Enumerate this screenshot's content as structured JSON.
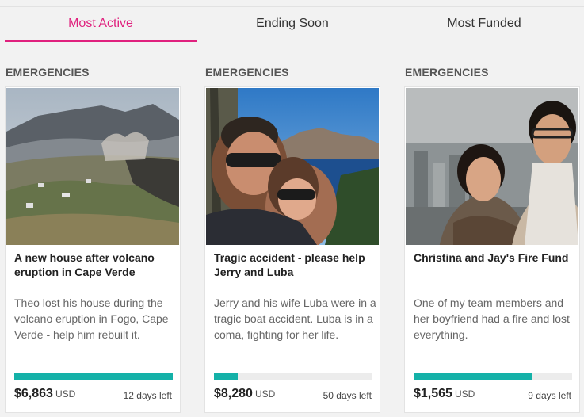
{
  "tabs": [
    {
      "label": "Most Active"
    },
    {
      "label": "Ending Soon"
    },
    {
      "label": "Most Funded"
    }
  ],
  "active_tab": "Most Active",
  "colors": {
    "accent": "#e0217e",
    "progress": "#14b1a8"
  },
  "campaigns": [
    {
      "category": "EMERGENCIES",
      "title": "A new house after volcano eruption in Cape Verde",
      "description": "Theo lost his house during the volcano eruption in Fogo, Cape Verde - help him rebuilt it.",
      "amount": "$6,863",
      "currency": "USD",
      "time_left": "12 days left",
      "progress": 1.0
    },
    {
      "category": "EMERGENCIES",
      "title": "Tragic accident - please help Jerry and Luba",
      "description": "Jerry and his wife Luba were in a tragic boat accident. Luba is in a coma, fighting for her life.",
      "amount": "$8,280",
      "currency": "USD",
      "time_left": "50 days left",
      "progress": 0.15
    },
    {
      "category": "EMERGENCIES",
      "title": "Christina and Jay's Fire Fund",
      "description": "One of my team members and her boyfriend had a fire and lost everything.",
      "amount": "$1,565",
      "currency": "USD",
      "time_left": "9 days left",
      "progress": 0.75
    }
  ]
}
